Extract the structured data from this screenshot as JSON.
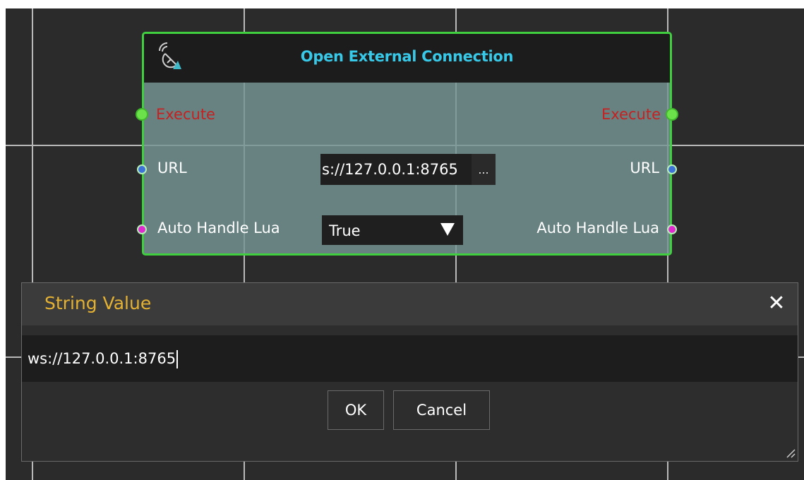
{
  "node": {
    "title": "Open External Connection",
    "icon": "satellite-dish-icon",
    "border_color": "#3fcf3f",
    "title_color": "#38c8e8",
    "inputs": [
      {
        "label": "Execute",
        "port": "green"
      },
      {
        "label": "URL",
        "port": "blue"
      },
      {
        "label": "Auto Handle Lua",
        "port": "magenta"
      }
    ],
    "outputs": [
      {
        "label": "Execute",
        "port": "green"
      },
      {
        "label": "URL",
        "port": "blue"
      },
      {
        "label": "Auto Handle Lua",
        "port": "magenta"
      }
    ],
    "url_field": {
      "value": "s://127.0.0.1:8765",
      "more_label": "..."
    },
    "lua_select": {
      "value": "True"
    }
  },
  "dialog": {
    "title": "String Value",
    "title_color": "#e4b132",
    "close_label": "✕",
    "input_value": "ws://127.0.0.1:8765",
    "ok_label": "OK",
    "cancel_label": "Cancel"
  }
}
